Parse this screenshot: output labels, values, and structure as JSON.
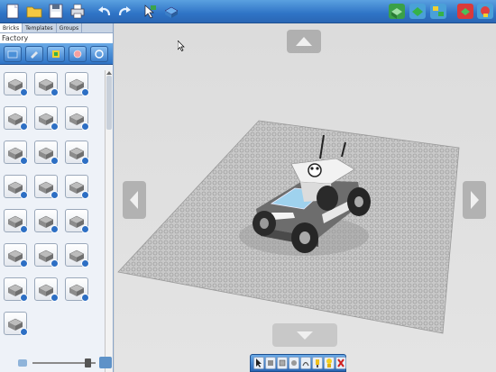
{
  "toolbar": {
    "buttons": [
      {
        "name": "new-file-button",
        "icon": "new-page-icon"
      },
      {
        "name": "open-button",
        "icon": "folder-icon"
      },
      {
        "name": "save-button",
        "icon": "floppy-icon"
      },
      {
        "name": "print-button",
        "icon": "printer-icon"
      },
      {
        "name": "undo-button",
        "icon": "undo-icon"
      },
      {
        "name": "redo-button",
        "icon": "redo-icon"
      },
      {
        "name": "select-tool-button",
        "icon": "select-arrow-icon"
      },
      {
        "name": "clone-button",
        "icon": "brick-clone-icon"
      },
      {
        "name": "build-mode-button",
        "icon": "build-mode-icon"
      },
      {
        "name": "view-mode-button",
        "icon": "view-mode-icon"
      },
      {
        "name": "instructions-mode-button",
        "icon": "instructions-icon"
      },
      {
        "name": "help-button",
        "icon": "help-icon"
      },
      {
        "name": "exit-button",
        "icon": "exit-icon"
      }
    ]
  },
  "left_panel": {
    "tabs": [
      {
        "label": "Bricks",
        "active": true
      },
      {
        "label": "Templates",
        "active": false
      },
      {
        "label": "Groups",
        "active": false
      }
    ],
    "palette_title": "Factory",
    "category_buttons": [
      "brick-category-icon",
      "tool-category-icon",
      "figure-category-icon",
      "decoration-category-icon",
      "theme-category-icon"
    ],
    "brick_icons": [
      "brick-2x2-icon",
      "brick-2x2-icon",
      "brick-2x2-icon",
      "brick-1x4-icon",
      "brick-2x4-icon",
      "brick-flat-icon",
      "brick-corner-icon",
      "brick-round-icon",
      "brick-round-icon",
      "brick-small-icon",
      "brick-panel-icon",
      "brick-axle-icon",
      "brick-window-icon",
      "wheel-icon",
      "brick-antenna-icon",
      "brick-technic-icon",
      "brick-clip-icon",
      "brick-hinge-icon",
      "brick-plate-icon",
      "brick-gear-icon",
      "brick-cylinder-icon",
      "brick-slope-icon"
    ]
  },
  "viewport": {
    "accent": "#2f74c6",
    "baseplate_color": "#c4c4c4",
    "model": "vehicle-model"
  },
  "bottom_bar": {
    "buttons": [
      "select-icon",
      "single-select-icon",
      "color-select-icon",
      "hinge-tool-icon",
      "flex-tool-icon",
      "paint-icon",
      "minifig-icon",
      "delete-icon"
    ]
  }
}
